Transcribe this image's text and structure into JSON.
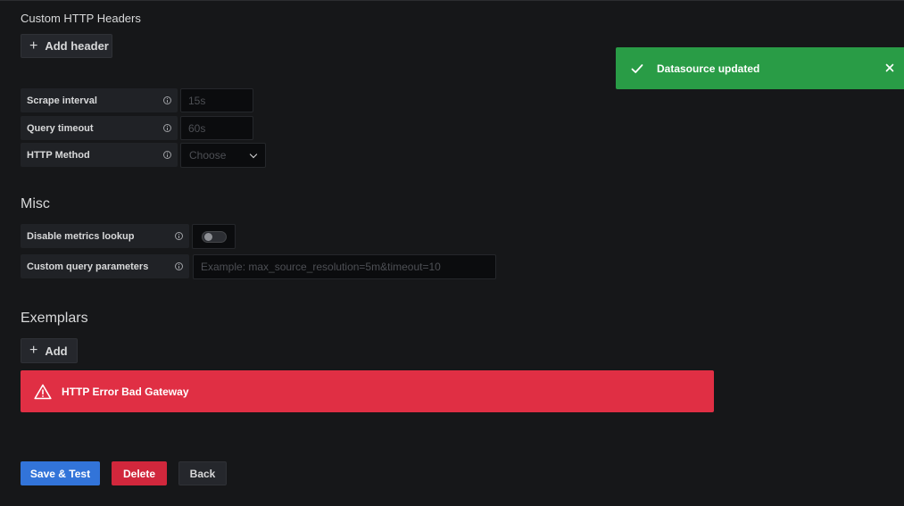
{
  "custom_headers": {
    "title": "Custom HTTP Headers",
    "add_header_label": "Add header"
  },
  "http_settings": {
    "scrape_interval": {
      "label": "Scrape interval",
      "placeholder": "15s"
    },
    "query_timeout": {
      "label": "Query timeout",
      "placeholder": "60s"
    },
    "http_method": {
      "label": "HTTP Method",
      "placeholder": "Choose"
    }
  },
  "misc": {
    "title": "Misc",
    "disable_metrics_lookup": {
      "label": "Disable metrics lookup",
      "enabled": false
    },
    "custom_query_parameters": {
      "label": "Custom query parameters",
      "placeholder": "Example: max_source_resolution=5m&timeout=10"
    }
  },
  "exemplars": {
    "title": "Exemplars",
    "add_label": "Add"
  },
  "alert": {
    "message": "HTTP Error Bad Gateway",
    "color": "#e02f44"
  },
  "toast": {
    "message": "Datasource updated",
    "color": "#299c46"
  },
  "footer": {
    "save_test_label": "Save & Test",
    "delete_label": "Delete",
    "back_label": "Back"
  },
  "colors": {
    "background": "#161719",
    "primary": "#3274d9",
    "danger": "#d1273c"
  }
}
